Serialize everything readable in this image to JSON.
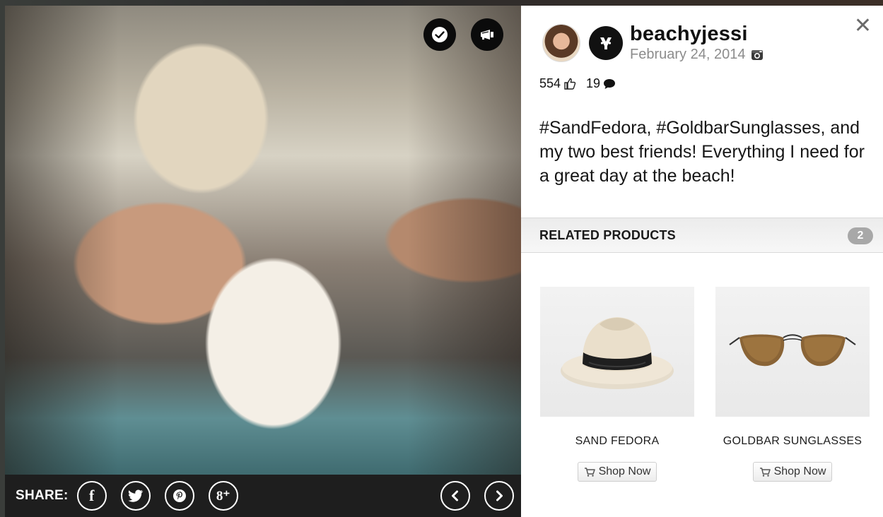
{
  "photo": {
    "alt_subject": "",
    "actions": {
      "check_icon": "check-icon",
      "promo_icon": "megaphone-icon"
    }
  },
  "share": {
    "label": "SHARE:",
    "buttons": [
      {
        "icon": "facebook-icon",
        "glyph": "f"
      },
      {
        "icon": "twitter-icon",
        "glyph": ""
      },
      {
        "icon": "pinterest-icon",
        "glyph": "℗"
      },
      {
        "icon": "google-plus-icon",
        "glyph": "8⁺"
      }
    ],
    "prev_icon": "chevron-left-icon",
    "next_icon": "chevron-right-icon"
  },
  "post": {
    "username": "beachyjessi",
    "date": "February 24, 2014",
    "likes": "554",
    "comments": "19",
    "caption": "#SandFedora, #GoldbarSunglasses, and my two best friends! Everything I need for a great day at the beach!"
  },
  "related": {
    "title": "RELATED PRODUCTS",
    "count": "2",
    "products": [
      {
        "name": "SAND FEDORA",
        "button": "Shop Now"
      },
      {
        "name": "GOLDBAR SUNGLASSES",
        "button": "Shop Now"
      }
    ]
  },
  "colors": {
    "dark": "#1e1e1e",
    "panel": "#ffffff",
    "muted": "#8c8c8c"
  }
}
